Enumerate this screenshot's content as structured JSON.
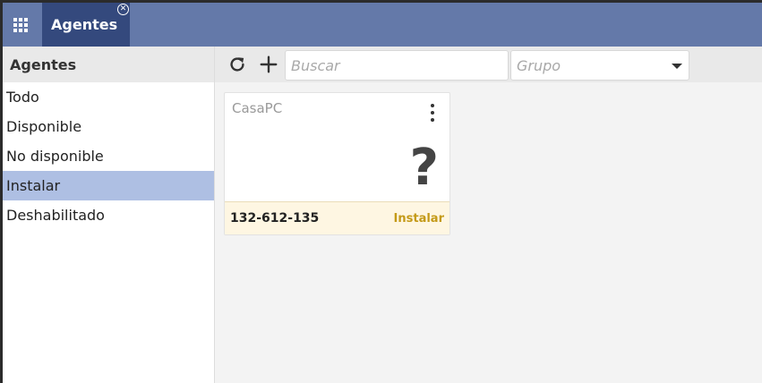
{
  "app": {
    "tab_label": "Agentes"
  },
  "sidebar": {
    "header": "Agentes",
    "items": [
      {
        "label": "Todo"
      },
      {
        "label": "Disponible"
      },
      {
        "label": "No disponible"
      },
      {
        "label": "Instalar",
        "selected": true
      },
      {
        "label": "Deshabilitado"
      }
    ]
  },
  "toolbar": {
    "search_placeholder": "Buscar",
    "group_placeholder": "Grupo",
    "refresh_icon": "refresh-icon",
    "add_icon": "plus-icon"
  },
  "cards": [
    {
      "name": "CasaPC",
      "id": "132-612-135",
      "action_label": "Instalar",
      "status_icon": "question-icon",
      "status_glyph": "?"
    }
  ],
  "colors": {
    "topbar": "#6479a9",
    "active_tab": "#34497d",
    "sidebar_selected": "#aebfe3",
    "card_footer": "#fef6e2",
    "action_text": "#c49a18"
  }
}
